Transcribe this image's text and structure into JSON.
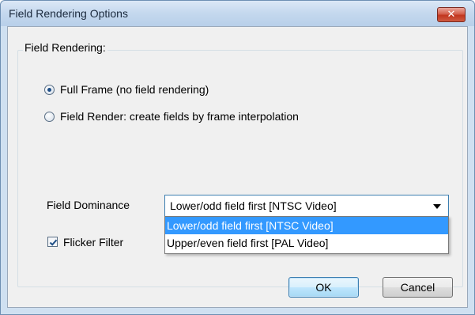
{
  "window": {
    "title": "Field Rendering Options"
  },
  "group": {
    "legend": "Field Rendering:"
  },
  "options": {
    "full_frame": {
      "label": "Full Frame (no field rendering)",
      "checked": true
    },
    "field_render": {
      "label": "Field Render: create fields by frame interpolation",
      "checked": false
    }
  },
  "field_dominance": {
    "label": "Field Dominance",
    "selected": "Lower/odd field first [NTSC Video]",
    "options": [
      "Lower/odd field first [NTSC Video]",
      "Upper/even field first [PAL Video]"
    ]
  },
  "flicker_filter": {
    "label": "Flicker Filter",
    "checked": true
  },
  "buttons": {
    "ok": "OK",
    "cancel": "Cancel"
  },
  "colors": {
    "selection": "#3399ff",
    "close_button": "#c1361f",
    "focus_border": "#3c7fb1"
  }
}
